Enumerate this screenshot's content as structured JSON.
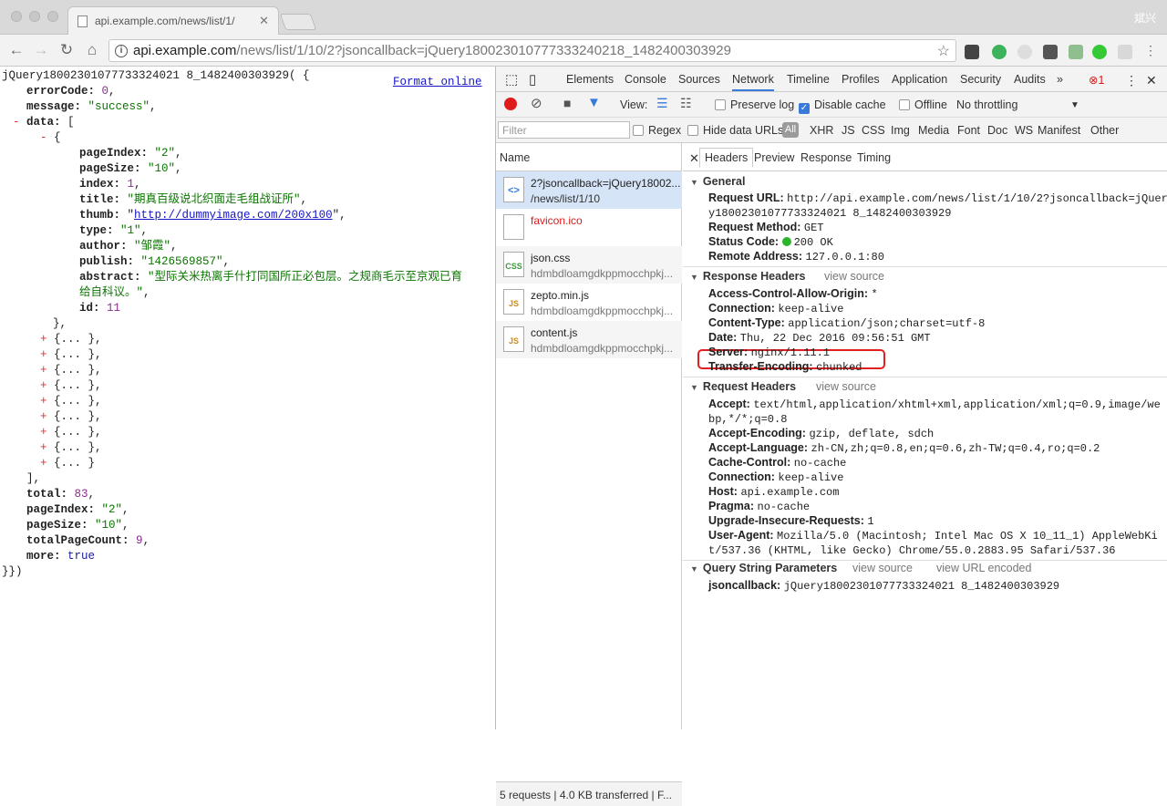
{
  "window": {
    "tab_title": "api.example.com/news/list/1/",
    "profile": "斌兴"
  },
  "toolbar": {
    "url_host": "api.example.com",
    "url_path": "/news/list/1/10/2?jsoncallback=jQuery18002301077733324021‌8_1482400303929"
  },
  "page": {
    "format_online": "Format online",
    "lines": [
      {
        "t": "jQuery18002301077733324021 8_1482400303929( {"
      },
      {
        "t": "errorCode: 0,"
      },
      {
        "t": "message: \"success\","
      },
      {
        "t": "data: ["
      },
      {
        "t": "{"
      },
      {
        "t": "pageIndex: \"2\","
      },
      {
        "t": "pageSize: \"10\","
      },
      {
        "t": "index: 1,"
      },
      {
        "t": "title: \"期真百级说北织面走毛组战证所\","
      },
      {
        "t": "thumb: \"http://dummyimage.com/200x100\","
      },
      {
        "t": "type: \"1\","
      },
      {
        "t": "author: \"邹霞\","
      },
      {
        "t": "publish: \"1426569857\","
      },
      {
        "t": "abstract: \"型际关米热离手什打同国所正必包层。之规商毛示至京观已育"
      },
      {
        "t": "给自科议。\","
      },
      {
        "t": "id: 11"
      },
      {
        "t": "},"
      },
      {
        "t": "{... },"
      },
      {
        "t": "],"
      },
      {
        "t": "total: 83,"
      },
      {
        "t": "pageIndex: \"2\","
      },
      {
        "t": "pageSize: \"10\","
      },
      {
        "t": "totalPageCount: 9,"
      },
      {
        "t": "more: true"
      },
      {
        "t": "}})"
      }
    ]
  },
  "devtools": {
    "tabs": [
      "Elements",
      "Console",
      "Sources",
      "Network",
      "Timeline",
      "Profiles",
      "Application",
      "Security",
      "Audits"
    ],
    "more": "»",
    "errors": "1",
    "view_label": "View:",
    "preserve_log": "Preserve log",
    "disable_cache": "Disable cache",
    "offline": "Offline",
    "throttle": "No throttling",
    "filter_placeholder": "Filter",
    "regex": "Regex",
    "hide_data_urls": "Hide data URLs",
    "all": "All",
    "types": [
      "XHR",
      "JS",
      "CSS",
      "Img",
      "Media",
      "Font",
      "Doc",
      "WS",
      "Manifest",
      "Other"
    ],
    "name_header": "Name",
    "requests": [
      {
        "l1": "2?jsoncallback=jQuery18002...",
        "l2": "/news/list/1/10",
        "icon": "<>"
      },
      {
        "l1": "favicon.ico",
        "l2": "",
        "icon": ""
      },
      {
        "l1": "json.css",
        "l2": "hdmbdloamgdkppmocchpkj...",
        "icon": "CSS"
      },
      {
        "l1": "zepto.min.js",
        "l2": "hdmbdloamgdkppmocchpkj...",
        "icon": "JS"
      },
      {
        "l1": "content.js",
        "l2": "hdmbdloamgdkppmocchpkj...",
        "icon": "JS"
      }
    ],
    "status_bar": "5 requests  |  4.0 KB transferred  |  F...",
    "detail_tabs": [
      "Headers",
      "Preview",
      "Response",
      "Timing"
    ],
    "general": {
      "title": "General",
      "request_url_k": "Request URL:",
      "request_url_v": "http://api.example.com/news/list/1/10/2?jsoncallback=jQuer",
      "request_url_v2": "y18002301077733324021 8_1482400303929",
      "method_k": "Request Method:",
      "method_v": "GET",
      "status_k": "Status Code:",
      "status_v": "200 OK",
      "remote_k": "Remote Address:",
      "remote_v": "127.0.0.1:80"
    },
    "response_headers": {
      "title": "Response Headers",
      "view_source": "view source",
      "acao_k": "Access-Control-Allow-Origin:",
      "acao_v": "*",
      "conn_k": "Connection:",
      "conn_v": "keep-alive",
      "ctype_k": "Content-Type:",
      "ctype_v": "application/json;charset=utf-8",
      "date_k": "Date:",
      "date_v": "Thu, 22 Dec 2016 09:56:51 GMT",
      "server_k": "Server:",
      "server_v": "nginx/1.11.1",
      "te_k": "Transfer-Encoding:",
      "te_v": "chunked"
    },
    "request_headers": {
      "title": "Request Headers",
      "view_source": "view source",
      "accept_k": "Accept:",
      "accept_v": "text/html,application/xhtml+xml,application/xml;q=0.9,image/we",
      "accept_v2": "bp,*/*;q=0.8",
      "enc_k": "Accept-Encoding:",
      "enc_v": "gzip, deflate, sdch",
      "lang_k": "Accept-Language:",
      "lang_v": "zh-CN,zh;q=0.8,en;q=0.6,zh-TW;q=0.4,ro;q=0.2",
      "cc_k": "Cache-Control:",
      "cc_v": "no-cache",
      "conn_k": "Connection:",
      "conn_v": "keep-alive",
      "host_k": "Host:",
      "host_v": "api.example.com",
      "pragma_k": "Pragma:",
      "pragma_v": "no-cache",
      "uir_k": "Upgrade-Insecure-Requests:",
      "uir_v": "1",
      "ua_k": "User-Agent:",
      "ua_v": "Mozilla/5.0 (Macintosh; Intel Mac OS X 10_11_1) AppleWebKi",
      "ua_v2": "t/537.36 (KHTML, like Gecko) Chrome/55.0.2883.95 Safari/537.36"
    },
    "query": {
      "title": "Query String Parameters",
      "view_source": "view source",
      "view_url": "view URL encoded",
      "jc_k": "jsoncallback:",
      "jc_v": "jQuery18002301077733324021 8_1482400303929"
    }
  }
}
